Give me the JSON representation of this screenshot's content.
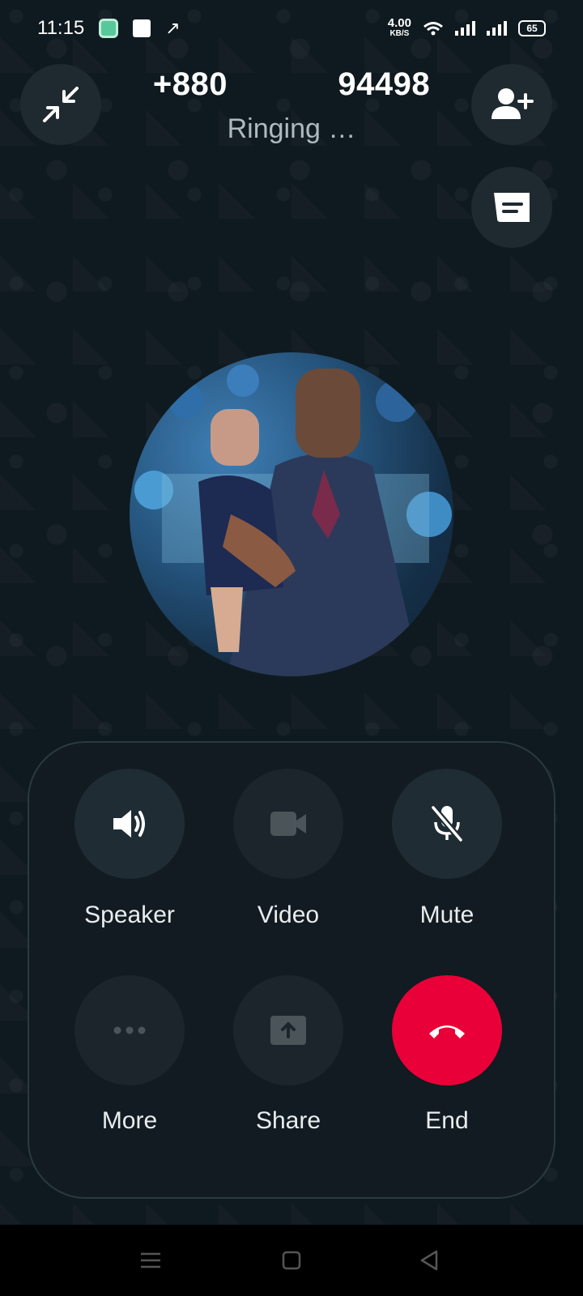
{
  "status_bar": {
    "time": "11:15",
    "net_speed_value": "4.00",
    "net_speed_unit": "KB/S",
    "battery": "65",
    "icons": [
      "app-notification-icon",
      "square-notification-icon",
      "arrow-up-right-icon",
      "wifi-icon",
      "signal-icon",
      "signal-icon",
      "battery-icon"
    ]
  },
  "call": {
    "number": "+880      94498",
    "status": "Ringing …"
  },
  "controls": {
    "speaker_label": "Speaker",
    "video_label": "Video",
    "mute_label": "Mute",
    "more_label": "More",
    "share_label": "Share",
    "end_label": "End"
  },
  "colors": {
    "background": "#0b141a",
    "panel": "#111b21",
    "button": "#202c33",
    "end": "#ea0038"
  }
}
